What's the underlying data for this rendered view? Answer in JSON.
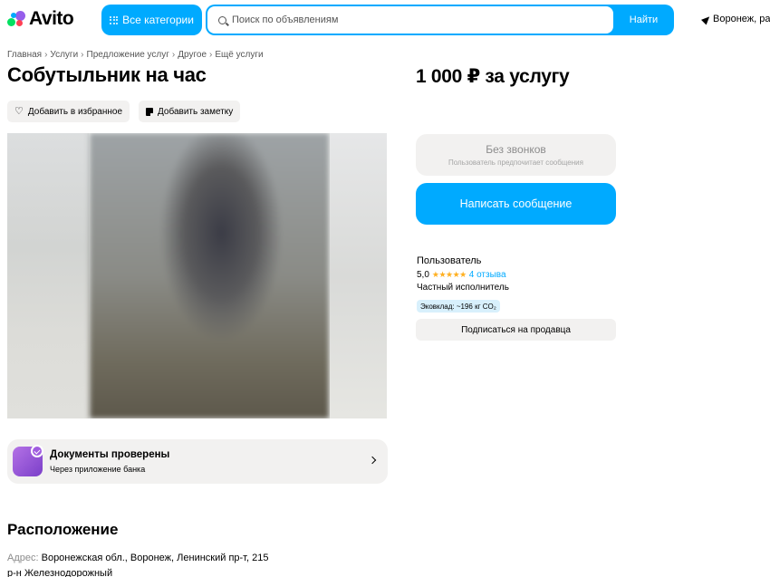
{
  "header": {
    "logo_text": "Avito",
    "categories_label": "Все категории",
    "search": {
      "placeholder": "Поиск по объявлениям",
      "button_label": "Найти"
    },
    "location": "Воронеж, ра"
  },
  "breadcrumb": [
    "Главная",
    "Услуги",
    "Предложение услуг",
    "Другое",
    "Ещё услуги"
  ],
  "breadcrumb_separator": "›",
  "listing": {
    "title": "Собутыльник на час",
    "price": "1 000 ₽ за услугу",
    "favorite_label": "Добавить в избранное",
    "note_label": "Добавить заметку"
  },
  "contact": {
    "no_calls_title": "Без звонков",
    "no_calls_sub": "Пользователь предпочитает сообщения",
    "message_button": "Написать сообщение"
  },
  "seller": {
    "name": "Пользователь",
    "rating": "5,0",
    "stars": "★★★★★",
    "reviews": "4 отзыва",
    "type": "Частный исполнитель",
    "eco": "Эковклад: ~196 кг CO₂",
    "subscribe_label": "Подписаться на продавца"
  },
  "documents": {
    "title": "Документы проверены",
    "subtitle": "Через приложение банка"
  },
  "location_section": {
    "title": "Расположение",
    "address_label": "Адрес:",
    "address": "Воронежская обл., Воронеж, Ленинский пр-т, 215",
    "district": "р-н Железнодорожный"
  },
  "colors": {
    "accent": "#00aaff",
    "chip_bg": "#f2f1f0",
    "star": "#ffb021"
  },
  "icons": [
    "search-icon",
    "grid-icon",
    "location-arrow-icon",
    "heart-icon",
    "note-icon",
    "check-badge-icon",
    "chevron-right-icon"
  ]
}
